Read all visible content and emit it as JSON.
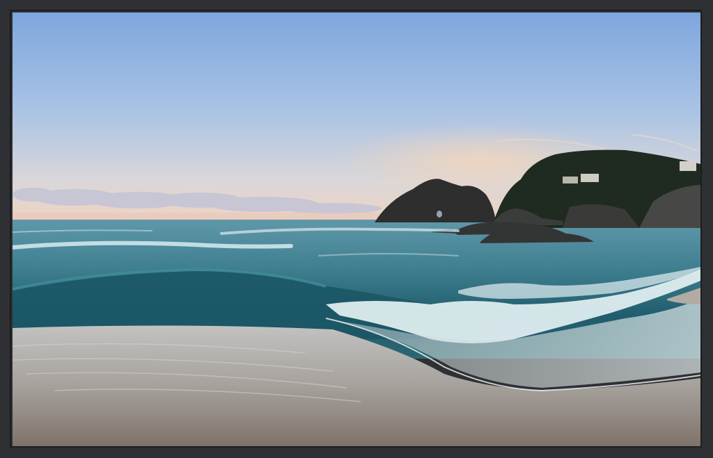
{
  "scene": {
    "subject": "beach-seascape",
    "frame_color": "#2f3033",
    "colors": {
      "sky_top": "#7fa7dc",
      "sky_mid": "#a9c2e2",
      "sky_horizon": "#e9d2c3",
      "sea_far": "#4f8fa2",
      "sea_near": "#1f5f6f",
      "wave_foam": "#e6f2f4",
      "sand_light": "#b9b7b3",
      "sand_dark": "#7a706a",
      "rock": "#2a2b2a",
      "headland_trees": "#1e2a1f"
    }
  }
}
